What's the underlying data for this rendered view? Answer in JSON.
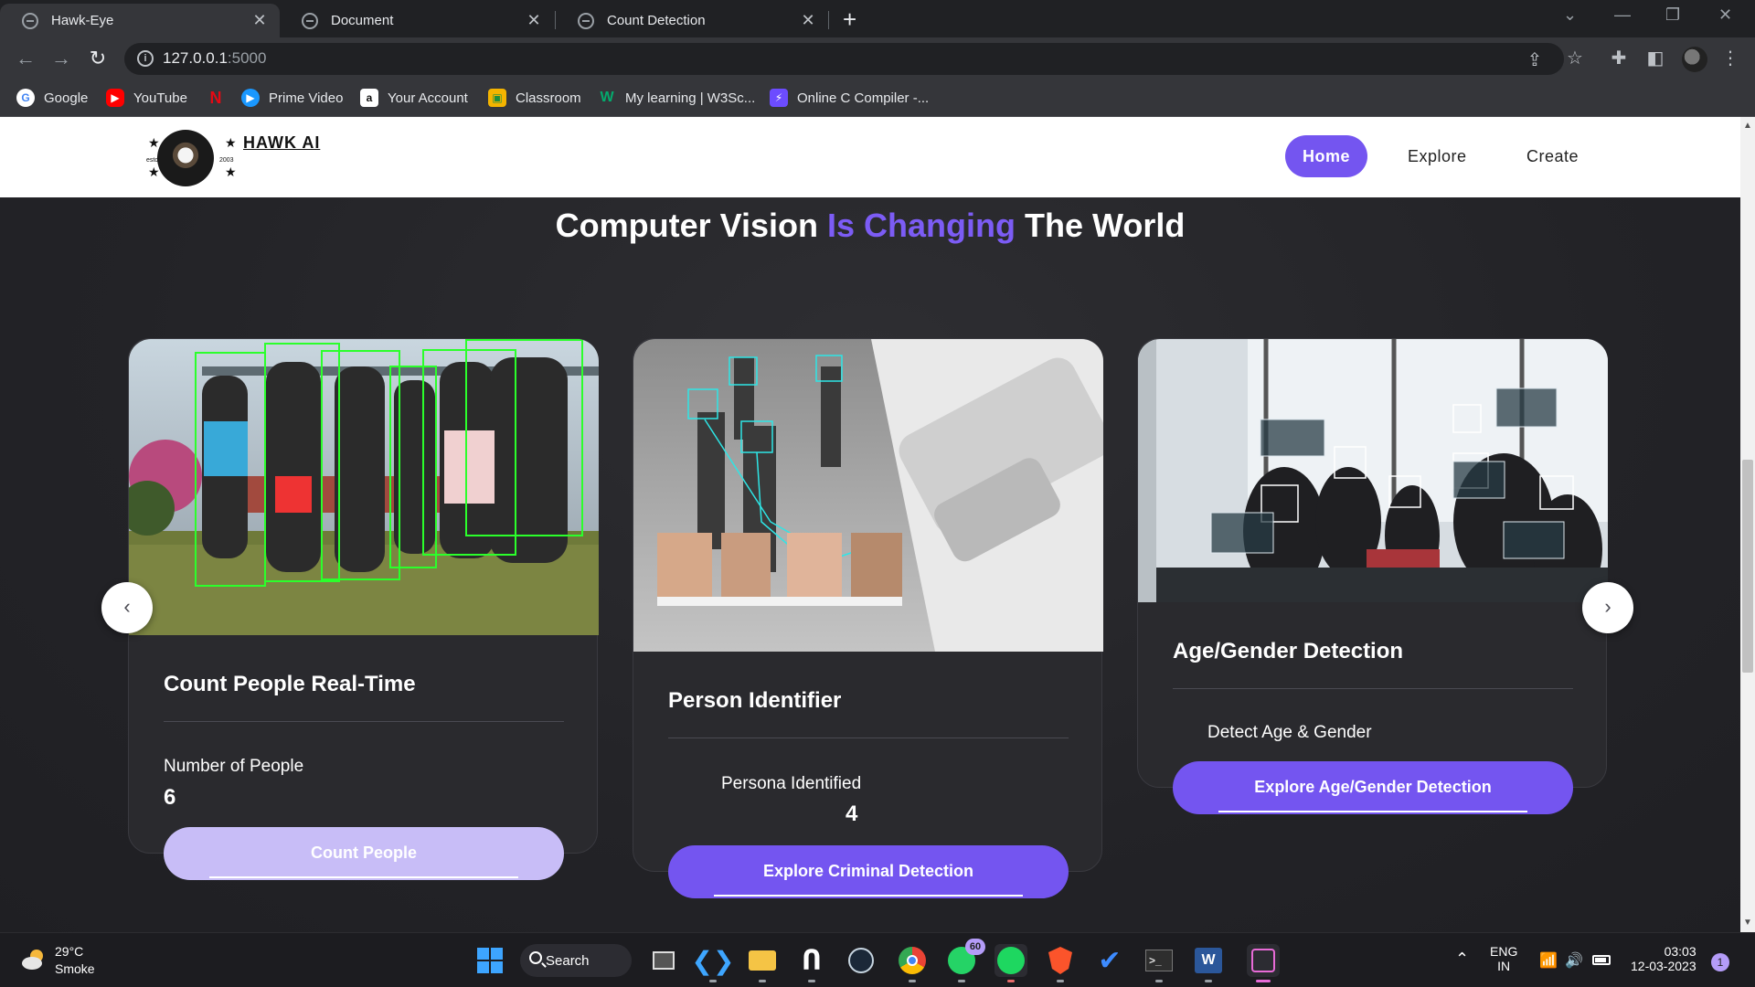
{
  "browser": {
    "tabs": [
      {
        "title": "Hawk-Eye",
        "active": true
      },
      {
        "title": "Document",
        "active": false
      },
      {
        "title": "Count Detection",
        "active": false
      }
    ],
    "close_glyph": "✕",
    "newtab_glyph": "+",
    "url_host": "127.0.0.1",
    "url_port": ":5000",
    "bookmarks": [
      {
        "label": "Google",
        "icon": "google-icon",
        "color": "#4285f4"
      },
      {
        "label": "YouTube",
        "icon": "youtube-icon",
        "color": "#ff0000"
      },
      {
        "label": "",
        "icon": "netflix-icon",
        "color": "#e50914"
      },
      {
        "label": "Prime Video",
        "icon": "prime-video-icon",
        "color": "#1a98ff"
      },
      {
        "label": "Your Account",
        "icon": "amazon-icon",
        "color": "#ffffff"
      },
      {
        "label": "Classroom",
        "icon": "classroom-icon",
        "color": "#f4b400"
      },
      {
        "label": "My learning | W3Sc...",
        "icon": "w3schools-icon",
        "color": "#04aa6d"
      },
      {
        "label": "Online C Compiler -...",
        "icon": "compiler-icon",
        "color": "#6c4cff"
      }
    ]
  },
  "site": {
    "logo_text": "HAWK AI",
    "logo_small_left": "estd",
    "logo_small_right": "2003",
    "nav": [
      {
        "label": "Home",
        "active": true
      },
      {
        "label": "Explore",
        "active": false
      },
      {
        "label": "Create",
        "active": false
      }
    ],
    "hero": {
      "part1": "Computer Vision ",
      "accent": "Is Changing",
      "part2": " The World"
    },
    "accent_color": "#7455f0",
    "prev_arrow": "‹",
    "next_arrow": "›",
    "cards": [
      {
        "title": "Count People Real-Time",
        "label": "Number of People",
        "value": "6",
        "button": "Count People",
        "button_disabled": true
      },
      {
        "title": "Person Identifier",
        "label": "Persona Identified",
        "value": "4",
        "button": "Explore Criminal Detection",
        "button_disabled": false
      },
      {
        "title": "Age/Gender Detection",
        "label": "Detect Age & Gender",
        "value": "",
        "button": "Explore Age/Gender Detection",
        "button_disabled": false
      }
    ]
  },
  "taskbar": {
    "weather_temp": "29°C",
    "weather_desc": "Smoke",
    "search_label": "Search",
    "whatsapp_badge": "60",
    "lang_top": "ENG",
    "lang_bottom": "IN",
    "time": "03:03",
    "date": "12-03-2023",
    "notification_count": "1"
  }
}
